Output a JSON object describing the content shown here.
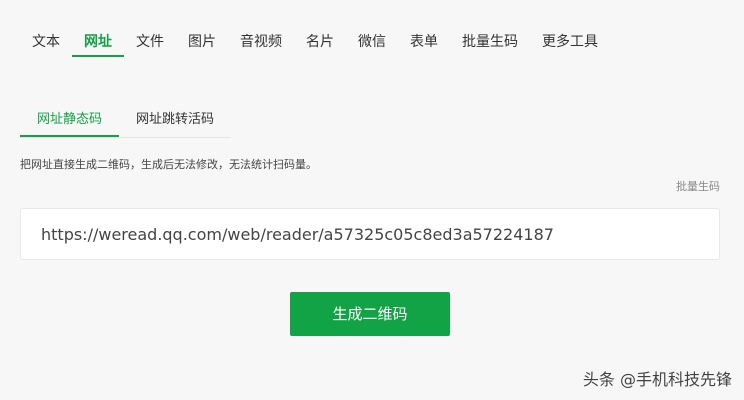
{
  "nav": {
    "tabs": [
      {
        "label": "文本"
      },
      {
        "label": "网址"
      },
      {
        "label": "文件"
      },
      {
        "label": "图片"
      },
      {
        "label": "音视频"
      },
      {
        "label": "名片"
      },
      {
        "label": "微信"
      },
      {
        "label": "表单"
      },
      {
        "label": "批量生码"
      },
      {
        "label": "更多工具"
      }
    ],
    "active_index": 1
  },
  "subtabs": {
    "items": [
      {
        "label": "网址静态码"
      },
      {
        "label": "网址跳转活码"
      }
    ],
    "active_index": 0
  },
  "description": "把网址直接生成二维码，生成后无法修改，无法统计扫码量。",
  "batch_link": "批量生码",
  "url_input": {
    "value": "https://weread.qq.com/web/reader/a57325c05c8ed3a57224187"
  },
  "generate_button": "生成二维码",
  "watermark": "头条 @手机科技先锋",
  "colors": {
    "accent": "#10a245",
    "background": "#f7f7f7"
  }
}
